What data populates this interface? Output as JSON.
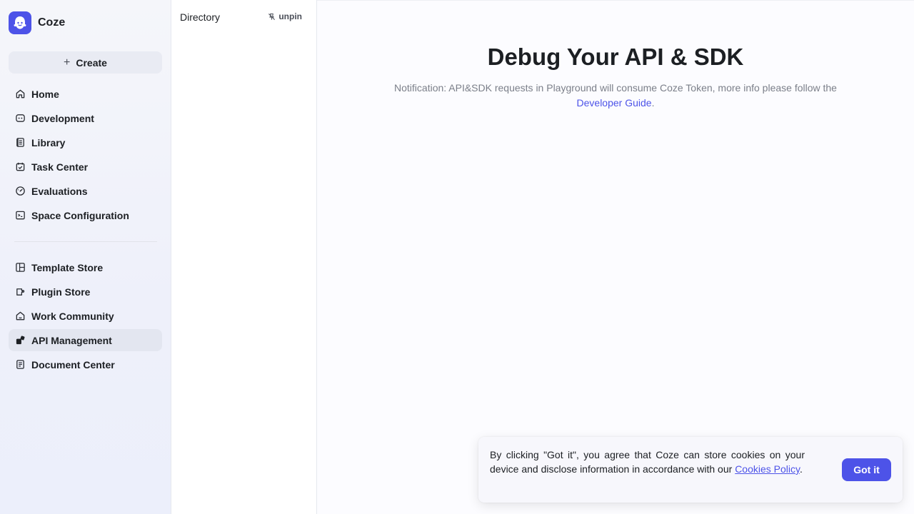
{
  "brand": {
    "name": "Coze"
  },
  "sidebar": {
    "create_label": "Create",
    "items": [
      {
        "label": "Home",
        "icon": "home-icon"
      },
      {
        "label": "Development",
        "icon": "development-icon"
      },
      {
        "label": "Library",
        "icon": "library-icon"
      },
      {
        "label": "Task Center",
        "icon": "task-center-icon"
      },
      {
        "label": "Evaluations",
        "icon": "evaluations-icon"
      },
      {
        "label": "Space Configuration",
        "icon": "space-configuration-icon"
      },
      {
        "label": "Template Store",
        "icon": "template-store-icon"
      },
      {
        "label": "Plugin Store",
        "icon": "plugin-store-icon"
      },
      {
        "label": "Work Community",
        "icon": "work-community-icon"
      },
      {
        "label": "API Management",
        "icon": "api-management-icon",
        "active": true
      },
      {
        "label": "Document Center",
        "icon": "document-center-icon"
      }
    ]
  },
  "directory": {
    "title": "Directory",
    "unpin_label": "unpin"
  },
  "main": {
    "title": "Debug Your API & SDK",
    "notice_text": "Notification: API&SDK requests in Playground will consume Coze Token, more info please follow the",
    "notice_link": "Developer Guide",
    "notice_end": "."
  },
  "cookie": {
    "text": "By clicking \"Got it\", you agree that Coze can store cookies on your device and disclose information in accordance with our",
    "link": "Cookies Policy",
    "end": ".",
    "button": "Got it"
  },
  "colors": {
    "accent": "#4d53e8",
    "text": "#1c1f23",
    "muted": "#7b7f89"
  }
}
